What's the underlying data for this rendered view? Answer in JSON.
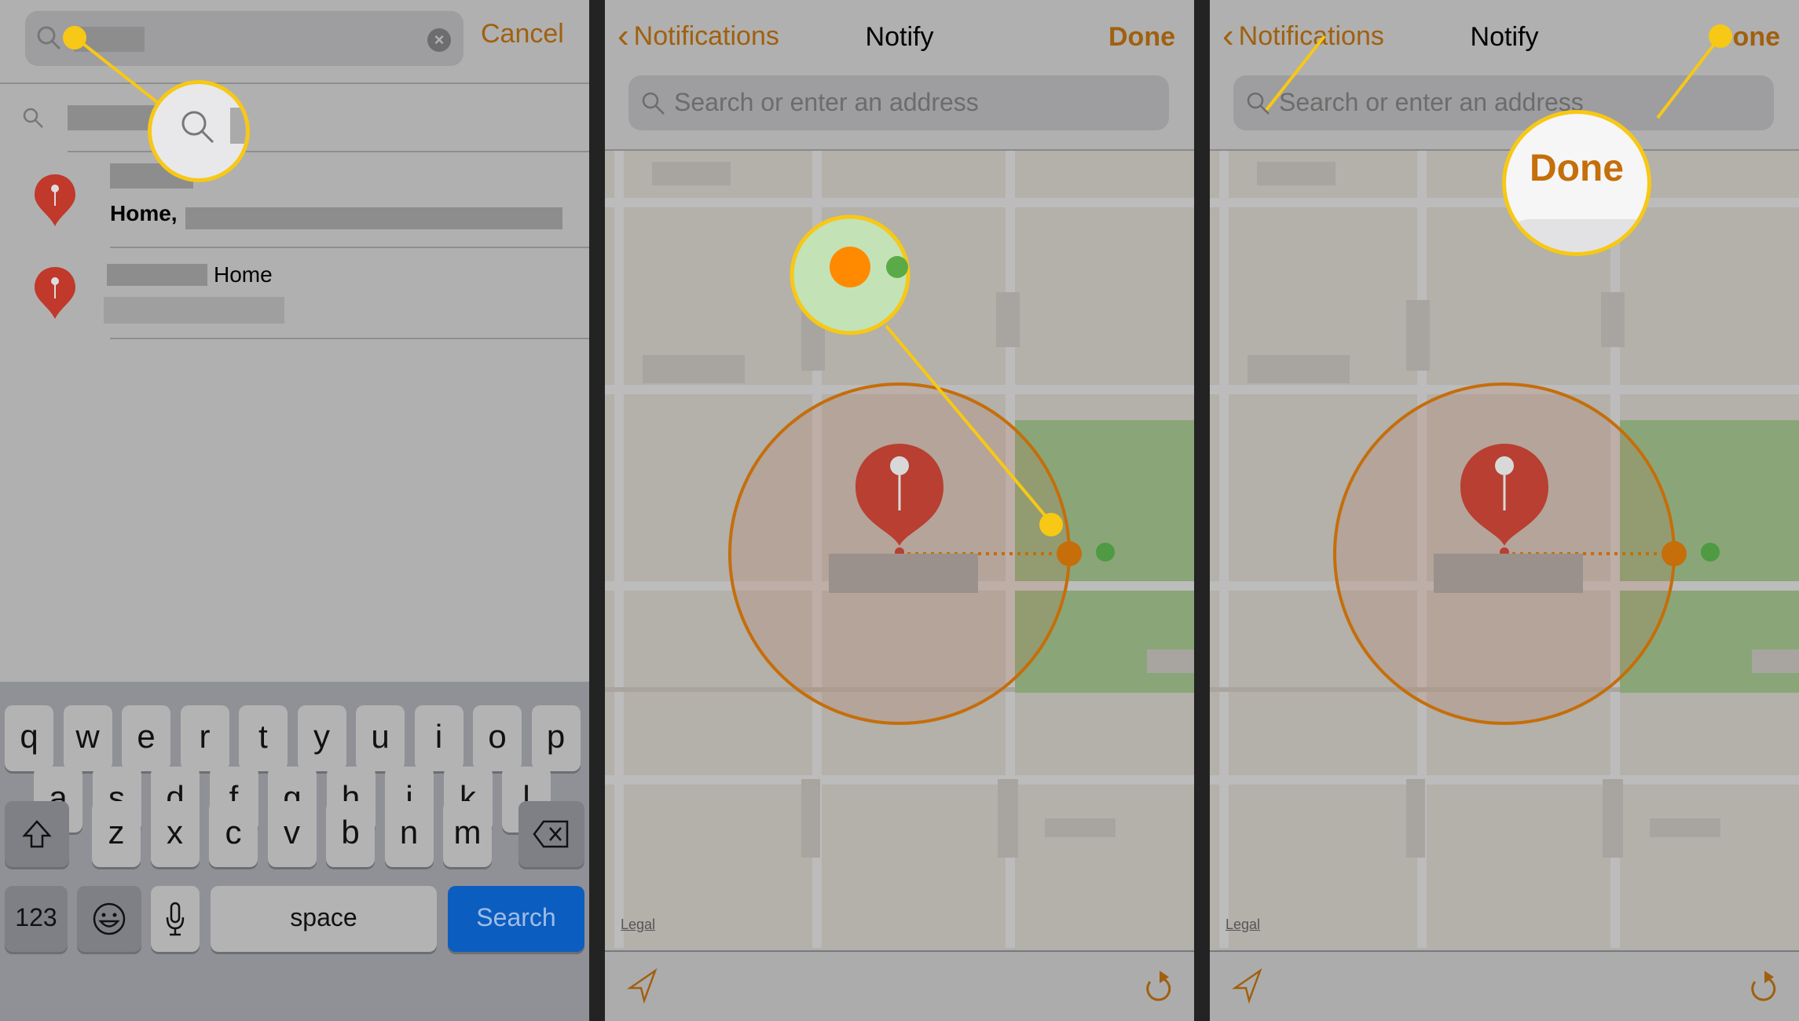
{
  "accent_color": "#a0600f",
  "callout_color": "#f7c815",
  "panel1": {
    "search": {
      "value_redacted": true,
      "clear_icon": "clear-icon",
      "cancel_label": "Cancel"
    },
    "suggestion": {
      "icon": "search-icon"
    },
    "results": [
      {
        "title_redacted": true,
        "subtitle": "Home, "
      },
      {
        "title_suffix": "Home",
        "subtitle_redacted": true
      }
    ],
    "keyboard": {
      "row1": [
        "q",
        "w",
        "e",
        "r",
        "t",
        "y",
        "u",
        "i",
        "o",
        "p"
      ],
      "row2": [
        "a",
        "s",
        "d",
        "f",
        "g",
        "h",
        "j",
        "k",
        "l"
      ],
      "row3": [
        "z",
        "x",
        "c",
        "v",
        "b",
        "n",
        "m"
      ],
      "shift_icon": "shift-icon",
      "delete_icon": "delete-icon",
      "numbers_label": "123",
      "emoji_icon": "emoji-icon",
      "mic_icon": "microphone-icon",
      "space_label": "space",
      "search_label": "Search"
    }
  },
  "panel2": {
    "back_label": "Notifications",
    "title": "Notify",
    "done_label": "Done",
    "address_placeholder": "Search or enter an address",
    "legal_label": "Legal"
  },
  "panel3": {
    "back_label": "Notifications",
    "title": "Notify",
    "done_label": "Done",
    "callout_label": "Done",
    "address_placeholder": "Search or enter an address",
    "legal_label": "Legal"
  }
}
